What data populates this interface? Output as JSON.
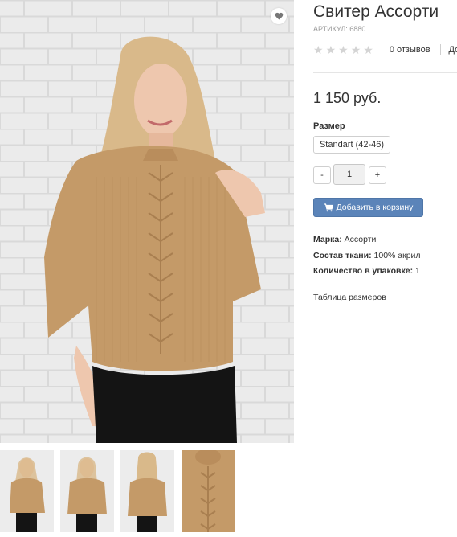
{
  "product": {
    "title": "Свитер Ассорти",
    "sku": "АРТИКУЛ: 6880",
    "reviews": "0 отзывов",
    "more_link": "До",
    "price": "1 150 руб.",
    "size_label": "Размер",
    "size_option": "Standart (42-46)",
    "qty_minus": "-",
    "qty_plus": "+",
    "qty_value": "1",
    "add_to_cart": "Добавить в корзину",
    "attributes": [
      {
        "label": "Марка:",
        "value": "Ассорти"
      },
      {
        "label": "Состав ткани:",
        "value": "100% акрил"
      },
      {
        "label": "Количество в упаковке:",
        "value": "1"
      }
    ],
    "size_table_link": "Таблица размеров"
  },
  "rating": {
    "stars_filled": 0,
    "stars_total": 5
  },
  "icons": {
    "wishlist": "heart-icon",
    "star": "star-icon",
    "cart": "cart-icon"
  },
  "colors": {
    "sweater": "#c49a68",
    "cart_button": "#5b84b9",
    "star_empty": "#d4d4d4"
  }
}
